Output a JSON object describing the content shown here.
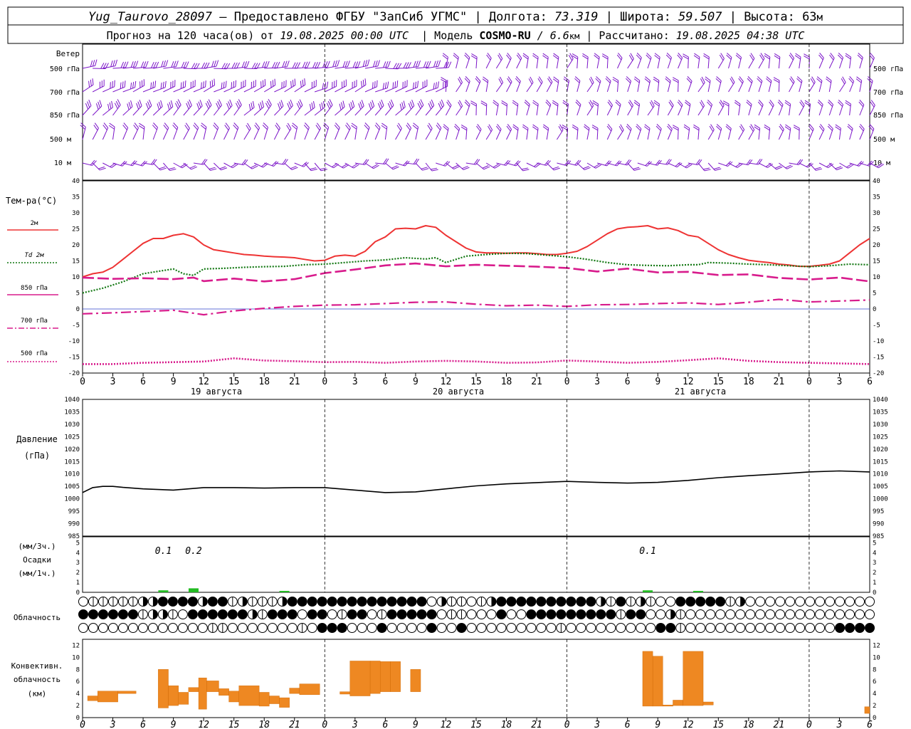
{
  "header": {
    "line1_station": "Yug_Taurovo_28097",
    "line1_provider": " – Предоставлено ФГБУ \"ЗапСиб УГМС\" | Долгота: ",
    "line1_lon": "73.319",
    "line1_lat_label": " | Широта: ",
    "line1_lat": "59.507",
    "line1_alt_label": " | Высота: 63",
    "line1_alt_unit": "м",
    "line2_prefix": "Прогноз на 120 часа(ов) от ",
    "line2_start": "19.08.2025 00:00 UTC",
    "line2_model_label": "  | Модель ",
    "line2_model": "COSMO-RU",
    "line2_res": " / 6.6",
    "line2_res_unit": "км",
    "line2_calc_label": " | Рассчитано: ",
    "line2_calc": "19.08.2025 04:38 UTC"
  },
  "wind_panel": {
    "title": "Ветер",
    "levels": [
      "500 гПа",
      "700 гПа",
      "850 гПа",
      "500 м",
      "10  м"
    ],
    "color": "#7b14c8"
  },
  "temp_panel": {
    "title": "Тем-ра(°C)",
    "legend": [
      {
        "label": "2м",
        "color": "#ee3333",
        "style": "solid"
      },
      {
        "label": "Td  2м",
        "color": "#117711",
        "style": "dotted"
      },
      {
        "label": "850 гПа",
        "color": "#d81b8c",
        "style": "dash"
      },
      {
        "label": "700 гПа",
        "color": "#d81b8c",
        "style": "dashdot"
      },
      {
        "label": "500 гПа",
        "color": "#d81b8c",
        "style": "dotted"
      }
    ],
    "ticks": [
      40,
      35,
      30,
      25,
      20,
      15,
      10,
      5,
      0,
      -5,
      -10,
      -15,
      -20
    ]
  },
  "time_axis": {
    "hour_labels": [
      "0",
      "3",
      "6",
      "9",
      "12",
      "15",
      "18",
      "21",
      "0",
      "3",
      "6",
      "9",
      "12",
      "15",
      "18",
      "21",
      "0",
      "3",
      "6",
      "9",
      "12",
      "15",
      "18",
      "21",
      "0",
      "3",
      "6"
    ],
    "day_labels": [
      "19 августа",
      "20 августа",
      "21 августа"
    ]
  },
  "pressure_panel": {
    "title": "Давление",
    "unit": "(гПа)",
    "ticks": [
      1040,
      1035,
      1030,
      1025,
      1020,
      1015,
      1010,
      1005,
      1000,
      995,
      990,
      985
    ]
  },
  "precip_panel": {
    "title1": "(мм/3ч.)",
    "title2": "Осадки",
    "title3": "(мм/1ч.)",
    "ticks": [
      "5",
      "4",
      "3",
      "2",
      "1",
      "0"
    ],
    "annotations": [
      {
        "hour": 8,
        "text": "0.1"
      },
      {
        "hour": 11,
        "text": "0.2"
      },
      {
        "hour": 56,
        "text": "0.1"
      }
    ],
    "color": "#22bb22"
  },
  "cloud_panel": {
    "title": "Облачность"
  },
  "conv_panel": {
    "title1": "Конвективн.",
    "title2": "облачность",
    "title3": "(км)",
    "ticks": [
      "12",
      "10",
      "8",
      "6",
      "4",
      "2",
      "0"
    ],
    "color": "#ee8822"
  },
  "chart_data": [
    {
      "type": "line",
      "title": "Тем-ра(°C)",
      "x_unit": "hours from 19.08.2025 00:00 UTC",
      "ylim": [
        -20,
        40
      ],
      "series": [
        {
          "name": "2м",
          "x": [
            0,
            1,
            2,
            3,
            4,
            5,
            6,
            7,
            8,
            9,
            10,
            11,
            12,
            13,
            14,
            15,
            16,
            17,
            18,
            19,
            20,
            21,
            22,
            23,
            24,
            25,
            26,
            27,
            28,
            29,
            30,
            31,
            32,
            33,
            34,
            35,
            36,
            37,
            38,
            39,
            40,
            41,
            42,
            43,
            44,
            45,
            46,
            47,
            48,
            49,
            50,
            51,
            52,
            53,
            54,
            55,
            56,
            57,
            58,
            59,
            60,
            61,
            62,
            63,
            64,
            65,
            66,
            67,
            68,
            69,
            70,
            71,
            72,
            73,
            74,
            75,
            76,
            77,
            78
          ],
          "values": [
            10,
            11,
            11.5,
            13,
            15.5,
            18,
            20.5,
            22,
            22,
            23,
            23.5,
            22.5,
            20,
            18.5,
            18,
            17.5,
            17,
            16.8,
            16.5,
            16.3,
            16.2,
            16,
            15.5,
            15,
            15.2,
            16.5,
            16.8,
            16.5,
            18,
            21,
            22.5,
            25,
            25.2,
            25,
            26,
            25.5,
            23,
            21,
            19,
            17.8,
            17.5,
            17.5,
            17.4,
            17.5,
            17.5,
            17.3,
            17,
            17,
            17.4,
            18,
            19.5,
            21.5,
            23.5,
            25,
            25.5,
            25.7,
            26,
            25,
            25.3,
            24.5,
            23,
            22.5,
            20.5,
            18.5,
            17,
            16,
            15.2,
            14.8,
            14.5,
            14,
            13.7,
            13.3,
            13.3,
            13.6,
            14,
            15,
            17.5,
            20,
            22
          ]
        },
        {
          "name": "Td  2м",
          "x": [
            0,
            2,
            4,
            6,
            8,
            9,
            10,
            11,
            12,
            14,
            16,
            18,
            20,
            22,
            24,
            26,
            28,
            30,
            32,
            34,
            35,
            36,
            38,
            40,
            42,
            44,
            46,
            48,
            50,
            52,
            54,
            56,
            58,
            60,
            61,
            62,
            64,
            66,
            68,
            70,
            72,
            74,
            76,
            78
          ],
          "values": [
            5,
            6.5,
            8.5,
            11,
            12,
            12.5,
            11,
            10.5,
            12.5,
            12.7,
            13,
            13.2,
            13.3,
            13.8,
            14,
            14.5,
            15,
            15.3,
            16,
            15.6,
            16,
            14.5,
            16.5,
            17,
            17.4,
            17.3,
            16.8,
            16.3,
            15.5,
            14.5,
            13.8,
            13.6,
            13.5,
            13.8,
            13.8,
            14.5,
            14.3,
            14,
            13.8,
            13.5,
            13.2,
            13.5,
            14,
            13.8
          ]
        },
        {
          "name": "850 гПа",
          "x": [
            0,
            3,
            6,
            9,
            11,
            12,
            15,
            18,
            21,
            24,
            27,
            30,
            33,
            36,
            39,
            42,
            45,
            48,
            51,
            54,
            57,
            60,
            63,
            66,
            69,
            72,
            75,
            78
          ],
          "values": [
            9.8,
            9.4,
            9.6,
            9.3,
            9.8,
            8.7,
            9.5,
            8.6,
            9.3,
            11.2,
            12.3,
            13.6,
            14.2,
            13.3,
            13.8,
            13.5,
            13.2,
            12.8,
            11.7,
            12.6,
            11.4,
            11.6,
            10.6,
            10.8,
            9.7,
            9.2,
            9.8,
            8.6
          ]
        },
        {
          "name": "700 гПа",
          "x": [
            0,
            3,
            6,
            9,
            12,
            15,
            18,
            21,
            24,
            27,
            30,
            33,
            36,
            39,
            42,
            45,
            48,
            51,
            54,
            57,
            60,
            63,
            66,
            69,
            72,
            75,
            78
          ],
          "values": [
            -1.5,
            -1.2,
            -0.8,
            -0.4,
            -1.8,
            -0.6,
            0.2,
            0.8,
            1.2,
            1.3,
            1.7,
            2.1,
            2.2,
            1.5,
            1.0,
            1.2,
            0.8,
            1.3,
            1.4,
            1.7,
            1.9,
            1.4,
            2.1,
            3.0,
            2.2,
            2.5,
            2.8
          ]
        },
        {
          "name": "500 гПа",
          "x": [
            0,
            3,
            6,
            9,
            12,
            15,
            18,
            21,
            24,
            27,
            30,
            33,
            36,
            39,
            42,
            45,
            48,
            51,
            54,
            57,
            60,
            63,
            66,
            69,
            72,
            75,
            78
          ],
          "values": [
            -17.2,
            -17.2,
            -16.8,
            -16.6,
            -16.4,
            -15.4,
            -16.1,
            -16.3,
            -16.6,
            -16.5,
            -16.8,
            -16.4,
            -16.2,
            -16.4,
            -16.8,
            -16.7,
            -16.1,
            -16.4,
            -16.8,
            -16.5,
            -16.0,
            -15.4,
            -16.2,
            -16.6,
            -16.8,
            -17.0,
            -17.2
          ]
        }
      ]
    },
    {
      "type": "line",
      "title": "Давление",
      "ylabel": "(гПа)",
      "ylim": [
        985,
        1040
      ],
      "series": [
        {
          "name": "",
          "x": [
            0,
            1,
            2,
            3,
            4,
            6,
            9,
            12,
            15,
            18,
            21,
            24,
            27,
            30,
            33,
            36,
            39,
            42,
            45,
            48,
            51,
            54,
            57,
            60,
            63,
            66,
            69,
            72,
            75,
            78
          ],
          "values": [
            1002.5,
            1004.5,
            1005,
            1005,
            1004.6,
            1004,
            1003.5,
            1004.5,
            1004.5,
            1004.3,
            1004.5,
            1004.5,
            1003.5,
            1002.5,
            1002.8,
            1004,
            1005.2,
            1006,
            1006.5,
            1007,
            1006.6,
            1006.3,
            1006.6,
            1007.4,
            1008.5,
            1009.3,
            1010,
            1010.8,
            1011.2,
            1010.8
          ]
        }
      ]
    },
    {
      "type": "bar",
      "title": "Осадки",
      "ylim": [
        0,
        5
      ],
      "x": [
        8,
        11,
        20,
        56,
        61
      ],
      "values": [
        0.1,
        0.2,
        0.05,
        0.1,
        0.05
      ]
    },
    {
      "type": "bar",
      "title": "Конвективн. облачность (км)",
      "ylim": [
        0,
        13
      ],
      "segments": [
        {
          "x0": 0.5,
          "x1": 1.5,
          "base": 2.8,
          "top": 3.6
        },
        {
          "x0": 1.5,
          "x1": 3.5,
          "base": 2.6,
          "top": 4.4
        },
        {
          "x0": 3.5,
          "x1": 5.3,
          "base": 4.0,
          "top": 4.4
        },
        {
          "x0": 7.5,
          "x1": 8.5,
          "base": 1.6,
          "top": 8.0
        },
        {
          "x0": 8.5,
          "x1": 9.5,
          "base": 2.0,
          "top": 5.3
        },
        {
          "x0": 9.5,
          "x1": 10.5,
          "base": 2.2,
          "top": 4.2
        },
        {
          "x0": 10.5,
          "x1": 11.5,
          "base": 4.3,
          "top": 5.0
        },
        {
          "x0": 11.5,
          "x1": 12.3,
          "base": 1.4,
          "top": 6.6
        },
        {
          "x0": 12.3,
          "x1": 13.5,
          "base": 4.3,
          "top": 6.1
        },
        {
          "x0": 13.5,
          "x1": 14.5,
          "base": 3.7,
          "top": 4.8
        },
        {
          "x0": 14.5,
          "x1": 15.5,
          "base": 2.6,
          "top": 4.4
        },
        {
          "x0": 15.5,
          "x1": 17.5,
          "base": 2.0,
          "top": 5.3
        },
        {
          "x0": 17.5,
          "x1": 18.5,
          "base": 1.9,
          "top": 4.2
        },
        {
          "x0": 18.5,
          "x1": 19.5,
          "base": 2.3,
          "top": 3.6
        },
        {
          "x0": 19.5,
          "x1": 20.5,
          "base": 1.7,
          "top": 3.3
        },
        {
          "x0": 20.5,
          "x1": 21.5,
          "base": 4.0,
          "top": 4.9
        },
        {
          "x0": 21.5,
          "x1": 23.5,
          "base": 3.8,
          "top": 5.6
        },
        {
          "x0": 25.5,
          "x1": 26.5,
          "base": 3.9,
          "top": 4.3
        },
        {
          "x0": 26.5,
          "x1": 28.5,
          "base": 3.6,
          "top": 9.4
        },
        {
          "x0": 28.5,
          "x1": 29.5,
          "base": 4.0,
          "top": 9.4
        },
        {
          "x0": 29.5,
          "x1": 30.5,
          "base": 4.3,
          "top": 9.3
        },
        {
          "x0": 30.5,
          "x1": 31.5,
          "base": 4.3,
          "top": 9.3
        },
        {
          "x0": 32.5,
          "x1": 33.5,
          "base": 4.3,
          "top": 8.0
        },
        {
          "x0": 55.5,
          "x1": 56.5,
          "base": 1.9,
          "top": 11.0
        },
        {
          "x0": 56.5,
          "x1": 57.5,
          "base": 1.9,
          "top": 10.2
        },
        {
          "x0": 57.5,
          "x1": 58.5,
          "base": 1.9,
          "top": 2.1
        },
        {
          "x0": 58.5,
          "x1": 59.5,
          "base": 2.0,
          "top": 2.9
        },
        {
          "x0": 59.5,
          "x1": 61.5,
          "base": 2.0,
          "top": 11.0
        },
        {
          "x0": 61.5,
          "x1": 62.5,
          "base": 2.1,
          "top": 2.6
        },
        {
          "x0": 77.5,
          "x1": 78.0,
          "base": 0.7,
          "top": 1.8
        }
      ]
    }
  ],
  "clouds": {
    "row1": "01111122333323312111233333333333333021101233333333332131210033333120000000000000000000",
    "row2": "33333312210333333213330330133013333301100030033333333313300210000000000000000000000000",
    "row3": "00000000000001100000001033300030000300300000000010000000003310000000000000003333300000"
  }
}
